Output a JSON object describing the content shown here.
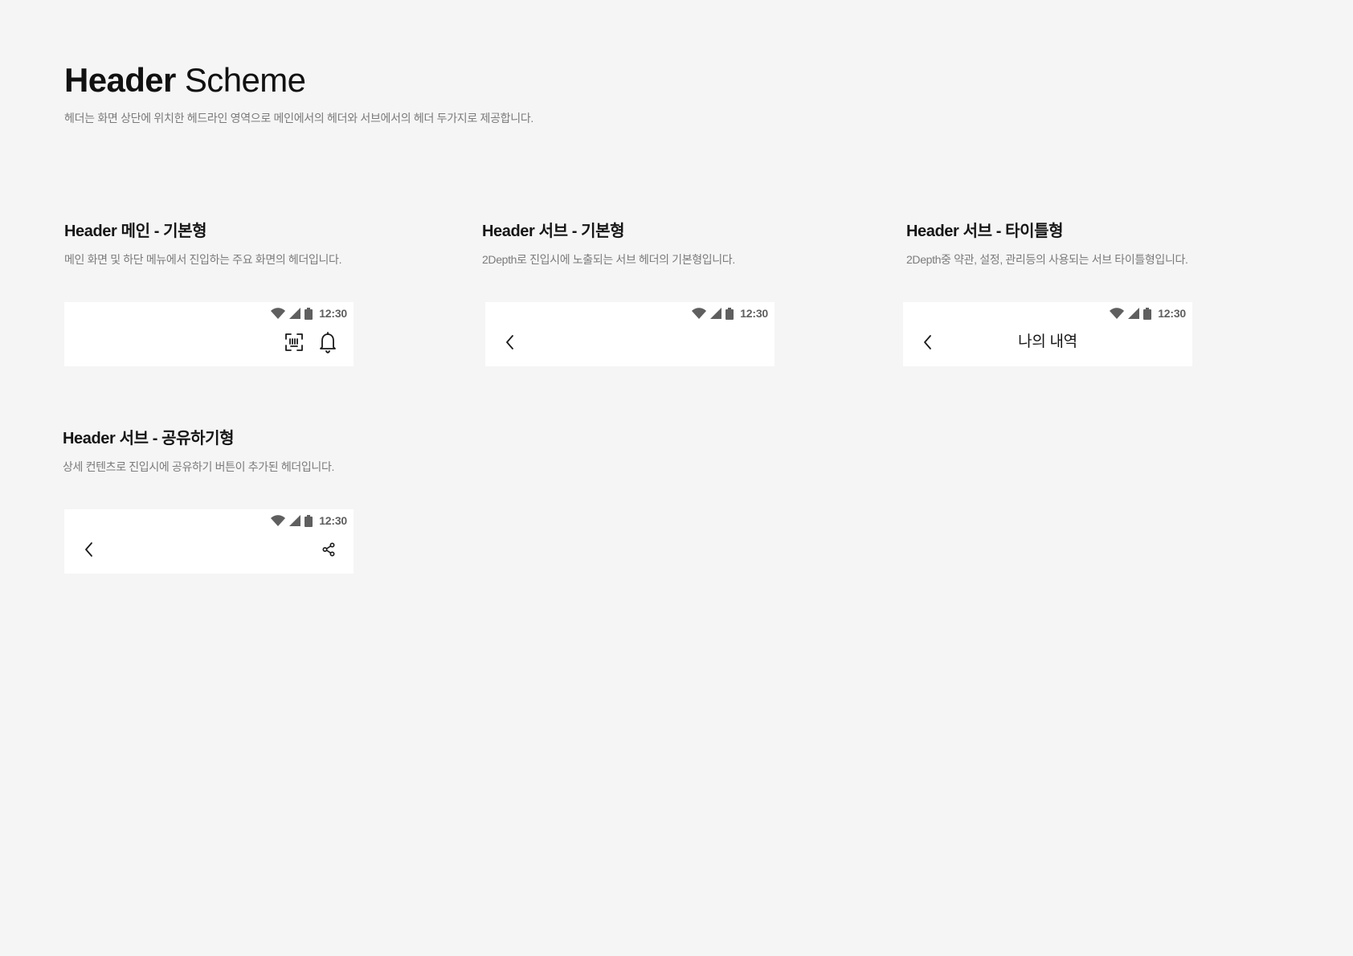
{
  "page": {
    "title_strong": "Header",
    "title_light": "Scheme",
    "description": "헤더는 화면 상단에 위치한 헤드라인 영역으로 메인에서의 헤더와 서브에서의 헤더 두가지로 제공합니다."
  },
  "sections": [
    {
      "title": "Header 메인 - 기본형",
      "description": "메인 화면 및 하단 메뉴에서 진입하는 주요 화면의 헤더입니다.",
      "header": {
        "time": "12:30",
        "icons": [
          "scan-icon",
          "bell-icon"
        ]
      }
    },
    {
      "title": "Header 서브 - 기본형",
      "description": "2Depth로 진입시에 노출되는 서브 헤더의 기본형입니다.",
      "header": {
        "time": "12:30",
        "icons": [
          "back-icon"
        ]
      }
    },
    {
      "title": "Header 서브 - 타이틀형",
      "description": "2Depth중 약관, 설정, 관리등의 사용되는 서브 타이틀형입니다.",
      "header": {
        "time": "12:30",
        "title": "나의 내역",
        "icons": [
          "back-icon"
        ]
      }
    },
    {
      "title": "Header 서브 - 공유하기형",
      "description": "상세 컨텐츠로 진입시에 공유하기 버튼이 추가된 헤더입니다.",
      "header": {
        "time": "12:30",
        "icons": [
          "back-icon",
          "share-icon"
        ]
      }
    }
  ],
  "colors": {
    "background": "#f5f5f5",
    "card": "#ffffff",
    "text": "#161616",
    "muted": "#7b7b7b",
    "status": "#5f5f5f"
  }
}
